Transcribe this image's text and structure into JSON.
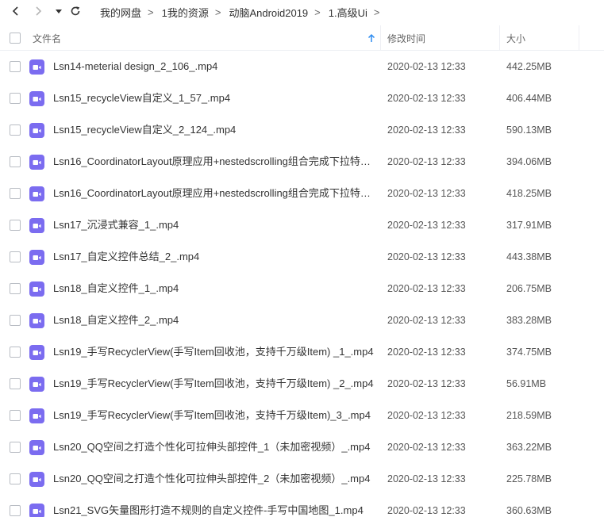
{
  "nav": {
    "back_icon": "chevron-left-icon",
    "forward_icon": "chevron-right-icon",
    "dropdown_icon": "caret-down-icon",
    "refresh_icon": "refresh-icon"
  },
  "breadcrumb": [
    {
      "label": "我的网盘"
    },
    {
      "label": "1我的资源"
    },
    {
      "label": "动脑Android2019"
    },
    {
      "label": "1.高级Ui"
    }
  ],
  "header": {
    "name_label": "文件名",
    "date_label": "修改时间",
    "size_label": "大小",
    "sort_icon": "sort-arrow-up-icon",
    "accent_color": "#2d8cf0"
  },
  "file_icon_color": "#7b6cf0",
  "files": [
    {
      "name": "Lsn14-meterial design_2_106_.mp4",
      "date": "2020-02-13 12:33",
      "size": "442.25MB"
    },
    {
      "name": "Lsn15_recycleView自定义_1_57_.mp4",
      "date": "2020-02-13 12:33",
      "size": "406.44MB"
    },
    {
      "name": "Lsn15_recycleView自定义_2_124_.mp4",
      "date": "2020-02-13 12:33",
      "size": "590.13MB"
    },
    {
      "name": "Lsn16_CoordinatorLayout原理应用+nestedscrolling组合完成下拉特效...",
      "date": "2020-02-13 12:33",
      "size": "394.06MB"
    },
    {
      "name": "Lsn16_CoordinatorLayout原理应用+nestedscrolling组合完成下拉特效...",
      "date": "2020-02-13 12:33",
      "size": "418.25MB"
    },
    {
      "name": "Lsn17_沉浸式兼容_1_.mp4",
      "date": "2020-02-13 12:33",
      "size": "317.91MB"
    },
    {
      "name": "Lsn17_自定义控件总结_2_.mp4",
      "date": "2020-02-13 12:33",
      "size": "443.38MB"
    },
    {
      "name": "Lsn18_自定义控件_1_.mp4",
      "date": "2020-02-13 12:33",
      "size": "206.75MB"
    },
    {
      "name": "Lsn18_自定义控件_2_.mp4",
      "date": "2020-02-13 12:33",
      "size": "383.28MB"
    },
    {
      "name": "Lsn19_手写RecyclerView(手写Item回收池，支持千万级Item) _1_.mp4",
      "date": "2020-02-13 12:33",
      "size": "374.75MB"
    },
    {
      "name": "Lsn19_手写RecyclerView(手写Item回收池，支持千万级Item) _2_.mp4",
      "date": "2020-02-13 12:33",
      "size": "56.91MB"
    },
    {
      "name": "Lsn19_手写RecyclerView(手写Item回收池，支持千万级Item)_3_.mp4",
      "date": "2020-02-13 12:33",
      "size": "218.59MB"
    },
    {
      "name": "Lsn20_QQ空间之打造个性化可拉伸头部控件_1（未加密视频）_.mp4",
      "date": "2020-02-13 12:33",
      "size": "363.22MB"
    },
    {
      "name": "Lsn20_QQ空间之打造个性化可拉伸头部控件_2（未加密视频）_.mp4",
      "date": "2020-02-13 12:33",
      "size": "225.78MB"
    },
    {
      "name": "Lsn21_SVG矢量图形打造不规则的自定义控件-手写中国地图_1.mp4",
      "date": "2020-02-13 12:33",
      "size": "360.63MB"
    }
  ]
}
